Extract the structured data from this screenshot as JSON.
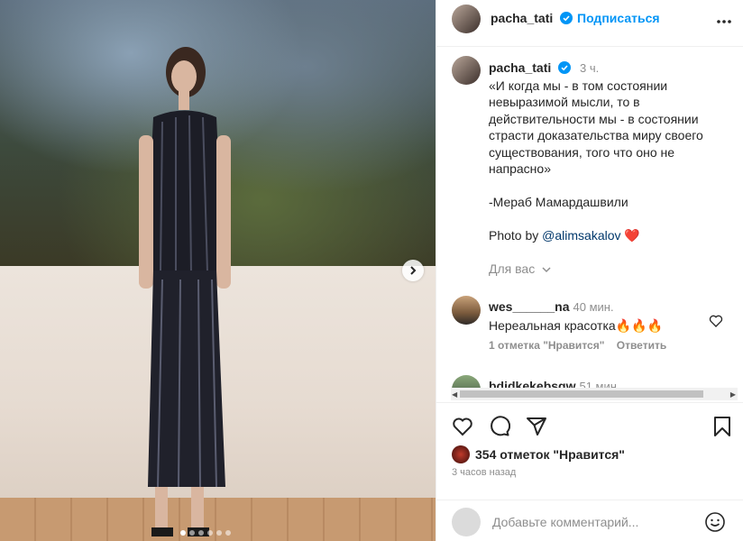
{
  "post": {
    "username": "pacha_tati",
    "follow_label": "Подписаться",
    "caption_time": "3 ч.",
    "caption_text": "«И когда мы - в том состоянии невыразимой мысли, то в действительности мы - в состоянии страсти доказательства миру своего существования, того что оно не напрасно»\n\n-Мераб Мамардашвили\n\nPhoto by ",
    "caption_mention": "@alimsakalov",
    "caption_emoji": "❤️",
    "for_you_label": "Для вас",
    "likes_text": "354 отметок \"Нравится\"",
    "posted_ago": "3 часов назад",
    "carousel_dots": 6,
    "carousel_active": 1
  },
  "comments": [
    {
      "username": "wes______na",
      "time": "40 мин.",
      "text": "Нереальная красотка🔥🔥🔥",
      "likes_label": "1 отметка \"Нравится\"",
      "reply_label": "Ответить"
    },
    {
      "username": "bdjdkekebsgw",
      "time": "51 мин."
    }
  ],
  "add_comment": {
    "placeholder": "Добавьте комментарий..."
  },
  "icons": {
    "verified": "verified-badge-icon",
    "more": "more-horizontal-icon",
    "like": "heart-icon",
    "comment": "comment-icon",
    "share": "paper-plane-icon",
    "save": "bookmark-icon",
    "emoji": "smile-icon",
    "next": "chevron-right-icon"
  },
  "colors": {
    "link": "#0095f6",
    "verified": "#0095f6",
    "mention": "#00376b"
  }
}
